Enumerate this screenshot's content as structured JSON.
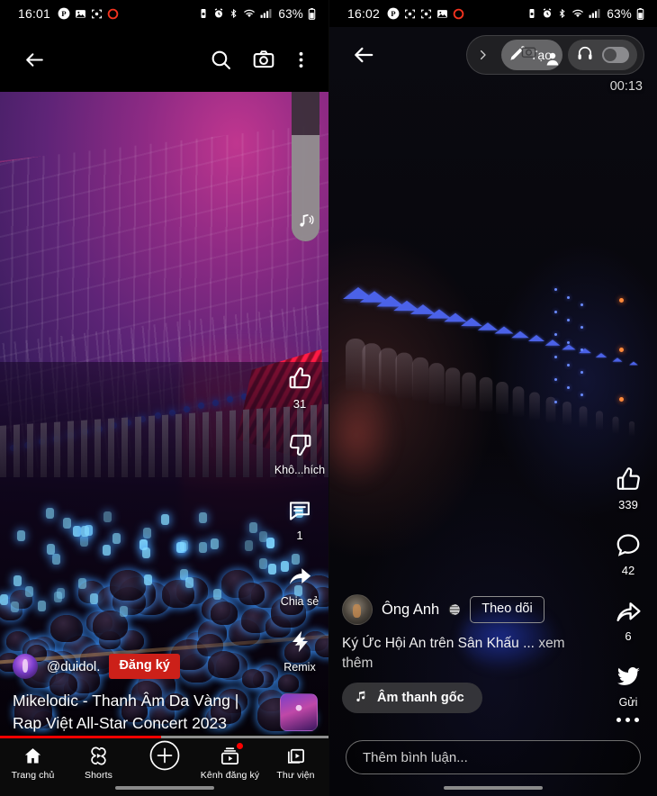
{
  "left_panel": {
    "app": "youtube-shorts",
    "status_bar": {
      "time": "16:01",
      "battery": "63%",
      "icons": [
        "pinterest-icon",
        "image-icon",
        "screenshot-icon",
        "record-icon",
        "vibrate-icon",
        "alarm-icon",
        "bluetooth-icon",
        "wifi-icon",
        "signal-icon",
        "battery-icon"
      ]
    },
    "header": {
      "back": "back-arrow",
      "search": "search-icon",
      "camera": "camera-icon",
      "menu": "kebab-menu-icon"
    },
    "volume_slider": {
      "level_percent": 62,
      "menu_icon": "ellipsis-icon",
      "sound_icon": "music-note-icon"
    },
    "actions": [
      {
        "icon": "thumbs-up-icon",
        "label": "31"
      },
      {
        "icon": "thumbs-down-icon",
        "label": "Khô...hích"
      },
      {
        "icon": "comment-icon",
        "label": "1"
      },
      {
        "icon": "share-icon",
        "label": "Chia sẻ"
      },
      {
        "icon": "remix-icon",
        "label": "Remix"
      }
    ],
    "channel": {
      "handle": "@duidol.",
      "subscribe_label": "Đăng ký",
      "subscribe_color": "#cc2019"
    },
    "video_title": "Mikelodic - Thanh Âm Da Vàng | Rap Việt All-Star Concert 2023",
    "progress_percent": 49,
    "progress_color": "#ff0000",
    "bottom_nav": [
      {
        "icon": "home-icon",
        "label": "Trang chủ",
        "badge": false
      },
      {
        "icon": "shorts-icon",
        "label": "Shorts",
        "badge": false
      },
      {
        "icon": "plus-icon",
        "label": "",
        "badge": false
      },
      {
        "icon": "subscriptions-icon",
        "label": "Kênh đăng ký",
        "badge": true
      },
      {
        "icon": "library-icon",
        "label": "Thư viện",
        "badge": false
      }
    ]
  },
  "right_panel": {
    "app": "facebook-reels",
    "status_bar": {
      "time": "16:02",
      "battery": "63%",
      "icons": [
        "pinterest-icon",
        "screenshot-icon",
        "screenshot-icon",
        "image-icon",
        "record-icon",
        "vibrate-icon",
        "alarm-icon",
        "bluetooth-icon",
        "wifi-icon",
        "signal-icon",
        "battery-icon"
      ]
    },
    "header": {
      "back": "back-arrow",
      "chevron": "chevron-right-icon",
      "pill_label": "Tạo",
      "pill_icons": [
        "pen-icon",
        "camera-icon",
        "person-icon"
      ],
      "headphone_icon": "headphones-icon",
      "toggle_icon": "toggle-switch"
    },
    "timestamp": "00:13",
    "actions": [
      {
        "icon": "thumbs-up-icon",
        "label": "339"
      },
      {
        "icon": "comment-icon",
        "label": "42"
      },
      {
        "icon": "share-icon",
        "label": "6"
      },
      {
        "icon": "twitter-bird-icon",
        "label": "Gửi"
      }
    ],
    "more_icon": "ellipsis-icon",
    "channel": {
      "name": "Ông Anh",
      "privacy_icon": "globe-icon",
      "follow_label": "Theo dõi"
    },
    "description": "Ký Ức Hội An trên Sân Khấu ...",
    "description_more": "xem thêm",
    "sound_chip": {
      "icon": "music-note-icon",
      "label": "Âm thanh gốc"
    },
    "comment_placeholder": "Thêm bình luận..."
  }
}
